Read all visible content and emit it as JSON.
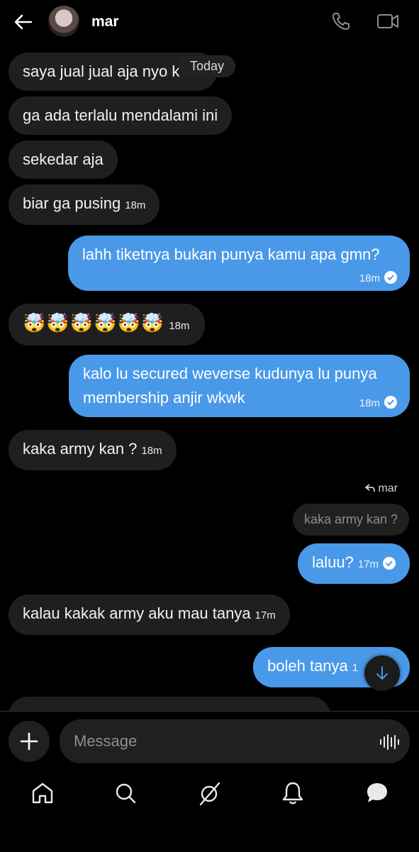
{
  "header": {
    "contact_name": "mar",
    "icons": [
      "back-arrow-icon",
      "avatar",
      "phone-icon",
      "video-icon"
    ]
  },
  "date_pill": "Today",
  "messages": [
    {
      "dir": "in",
      "text": "saya jual jual aja nyo k",
      "time": ""
    },
    {
      "dir": "in",
      "text": "ga ada terlalu mendalami ini",
      "time": ""
    },
    {
      "dir": "in",
      "text": "sekedar aja",
      "time": ""
    },
    {
      "dir": "in",
      "text": "biar ga pusing",
      "time": "18m"
    },
    {
      "dir": "out",
      "text": "lahh tiketnya bukan punya kamu apa gmn?",
      "time": "18m"
    },
    {
      "dir": "in",
      "text": "🤯🤯🤯🤯🤯🤯",
      "time": "18m"
    },
    {
      "dir": "out",
      "text_line1": "kalo lu secured weverse kudunya lu punya",
      "text_line2": "membership anjir wkwk",
      "time": "18m"
    },
    {
      "dir": "in",
      "text": "kaka army kan ?",
      "time": "18m"
    },
    {
      "dir": "out",
      "reply_to_name": "mar",
      "reply_to_text": "kaka army kan ?",
      "text": "laluu?",
      "time": "17m"
    },
    {
      "dir": "in",
      "text": "kalau kakak army aku mau tanya",
      "time": "17m"
    },
    {
      "dir": "out",
      "text": "boleh tanya",
      "time": "1"
    }
  ],
  "composer": {
    "placeholder": "Message",
    "icons": [
      "plus-icon",
      "voice-wave-icon"
    ]
  },
  "bottom_nav": [
    "home-icon",
    "search-icon",
    "grok-icon",
    "notifications-icon",
    "messages-icon"
  ],
  "colors": {
    "background": "#000000",
    "incoming_bubble": "#1f1f1f",
    "outgoing_bubble": "#4a99e9"
  }
}
